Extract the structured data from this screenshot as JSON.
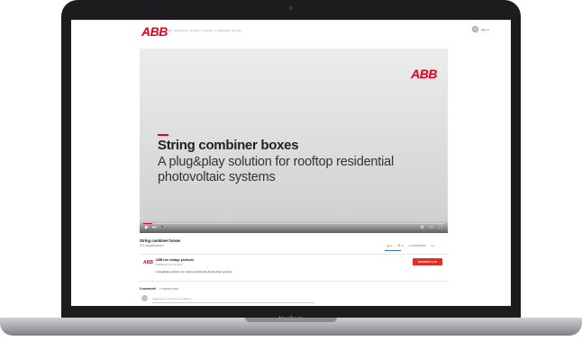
{
  "device": {
    "brand": "MacBook"
  },
  "header": {
    "logo": "ABB",
    "breadcrumb": "ABB / PRODUCT GUIDE / STRING COMBINER BOXES",
    "user_label": "Sign in"
  },
  "video": {
    "logo": "ABB",
    "title": "String combiner boxes",
    "subtitle": "A plug&play solution for rooftop residential photovoltaic systems",
    "progress": 0.03
  },
  "details": {
    "title": "String combiner boxes",
    "views": "973 visualizzazioni",
    "actions": {
      "like_count": "4",
      "dislike_count": "0",
      "share_label": "CONDIVIDI",
      "save_label": "…"
    },
    "channel": {
      "logo": "ABB",
      "name": "ABB low voltage products",
      "date": "Pubblicato il 22 ott 2017",
      "description": "A plug&play solution for rooftop residential photovoltaic systems"
    },
    "subscribe_label": "ISCRIVITI  1,9K",
    "comments": {
      "label": "0 commenti",
      "sort_label": "ORDINA PER",
      "placeholder": "Aggiungi un commento pubblico..."
    }
  },
  "colors": {
    "brand_red": "#e2001a",
    "subscribe_red": "#e52d27"
  }
}
